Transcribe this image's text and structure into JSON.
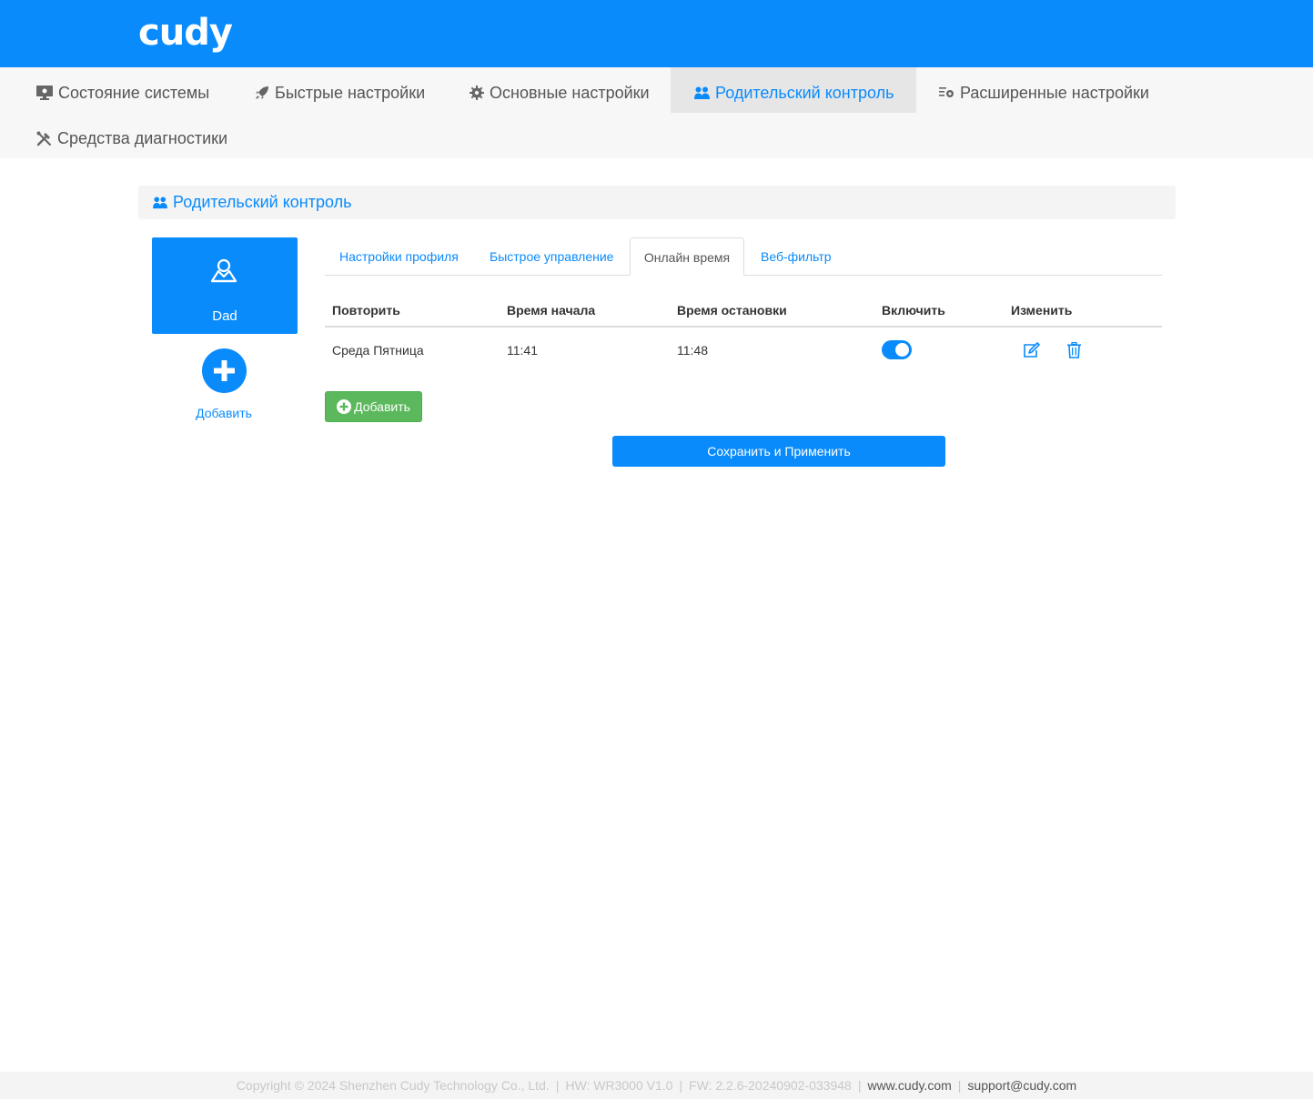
{
  "brand": {
    "logo": "cudy"
  },
  "nav": {
    "items": [
      {
        "label": "Состояние системы"
      },
      {
        "label": "Быстрые настройки"
      },
      {
        "label": "Основные настройки"
      },
      {
        "label": "Родительский контроль"
      },
      {
        "label": "Расширенные настройки"
      },
      {
        "label": "Средства диагностики"
      }
    ],
    "active": "Родительский контроль"
  },
  "section": {
    "title": "Родительский контроль"
  },
  "profiles": {
    "items": [
      {
        "name": "Dad"
      }
    ],
    "add_label": "Добавить"
  },
  "tabs": {
    "items": [
      {
        "label": "Настройки профиля"
      },
      {
        "label": "Быстрое управление"
      },
      {
        "label": "Онлайн время"
      },
      {
        "label": "Веб-фильтр"
      }
    ],
    "active": "Онлайн время"
  },
  "schedule": {
    "columns": {
      "repeat": "Повторить",
      "start": "Время начала",
      "stop": "Время остановки",
      "enable": "Включить",
      "edit": "Изменить"
    },
    "rows": [
      {
        "repeat": "Среда Пятница",
        "start": "11:41",
        "stop": "11:48",
        "enabled": true
      }
    ]
  },
  "buttons": {
    "add": "Добавить",
    "save": "Сохранить и Применить"
  },
  "footer": {
    "copyright": "Copyright © 2024 Shenzhen Cudy Technology Co., Ltd.",
    "hw": "HW: WR3000 V1.0",
    "fw": "FW: 2.2.6-20240902-033948",
    "site": "www.cudy.com",
    "email": "support@cudy.com"
  },
  "colors": {
    "accent": "#0a8bfc",
    "success": "#5cb85c",
    "nav_bg": "#f7f7f7",
    "active_nav_bg": "#e6e6e6"
  }
}
